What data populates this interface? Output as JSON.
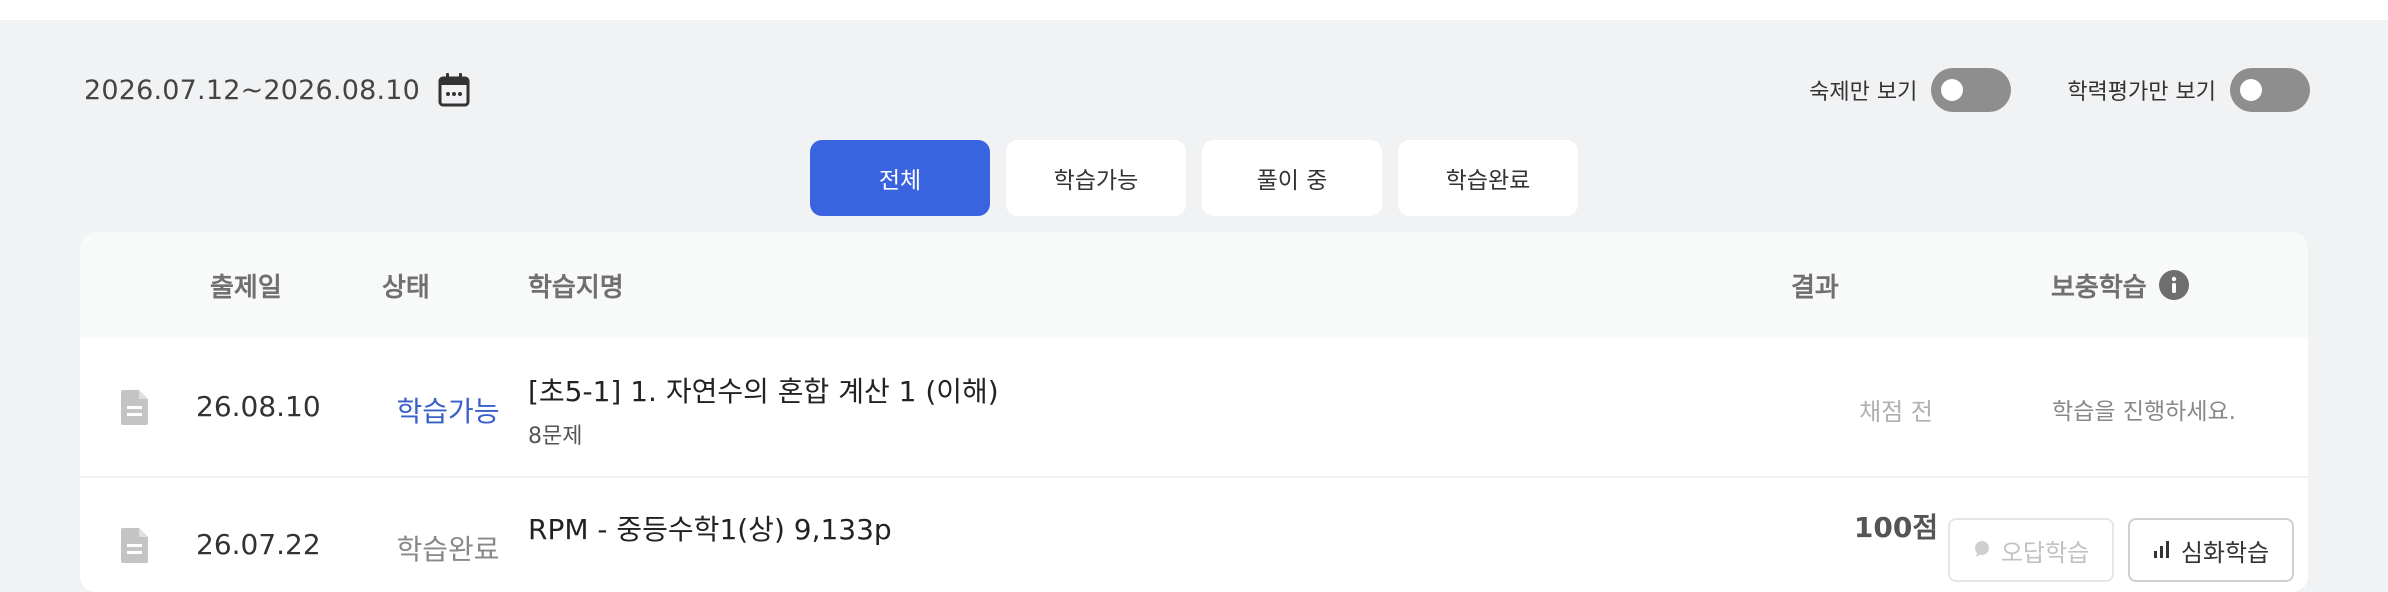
{
  "date_range": {
    "text": "2026.07.12~2026.08.10",
    "icon": "calendar-icon"
  },
  "toggles": [
    {
      "label": "숙제만 보기",
      "on": false
    },
    {
      "label": "학력평가만 보기",
      "on": false
    }
  ],
  "tabs": [
    {
      "label": "전체",
      "active": true
    },
    {
      "label": "학습가능",
      "active": false
    },
    {
      "label": "풀이 중",
      "active": false
    },
    {
      "label": "학습완료",
      "active": false
    }
  ],
  "table": {
    "headers": {
      "date": "출제일",
      "status": "상태",
      "name": "학습지명",
      "result": "결과",
      "supplement": "보충학습"
    },
    "rows": [
      {
        "date": "26.08.10",
        "status": "학습가능",
        "title": "[초5-1] 1. 자연수의 혼합 계산 1 (이해)",
        "subtitle": "8문제",
        "result": "채점 전",
        "supplement": "학습을 진행하세요."
      },
      {
        "date": "26.07.22",
        "status": "학습완료",
        "title": "RPM - 중등수학1(상) 9,133p",
        "result": "100점",
        "buttons": {
          "wrong_answer": "오답학습",
          "advanced": "심화학습"
        }
      }
    ]
  },
  "colors": {
    "accent": "#3a63e0",
    "status_available": "#3a5fc8",
    "toggle_off": "#8e8e8e",
    "background": "#f1f2f4"
  }
}
